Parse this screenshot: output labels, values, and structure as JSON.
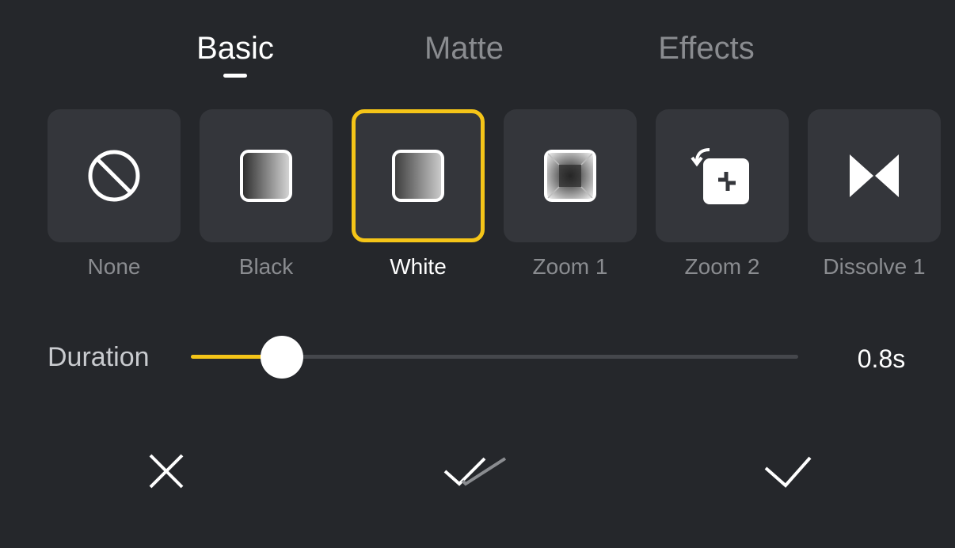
{
  "tabs": [
    {
      "label": "Basic",
      "active": true
    },
    {
      "label": "Matte",
      "active": false
    },
    {
      "label": "Effects",
      "active": false
    }
  ],
  "transitions": [
    {
      "label": "None",
      "icon": "prohibited-icon",
      "selected": false
    },
    {
      "label": "Black",
      "icon": "black-fade-icon",
      "selected": false
    },
    {
      "label": "White",
      "icon": "white-fade-icon",
      "selected": true
    },
    {
      "label": "Zoom 1",
      "icon": "zoom-in-icon",
      "selected": false
    },
    {
      "label": "Zoom 2",
      "icon": "zoom-out-icon",
      "selected": false
    },
    {
      "label": "Dissolve 1",
      "icon": "dissolve-icon",
      "selected": false
    }
  ],
  "duration": {
    "label": "Duration",
    "value_text": "0.8s",
    "fraction": 0.15
  },
  "actions": {
    "cancel_icon": "close-icon",
    "apply_all_icon": "double-check-icon",
    "confirm_icon": "check-icon"
  },
  "colors": {
    "accent": "#f5c518",
    "background": "#25272b",
    "tile": "#34363b"
  }
}
